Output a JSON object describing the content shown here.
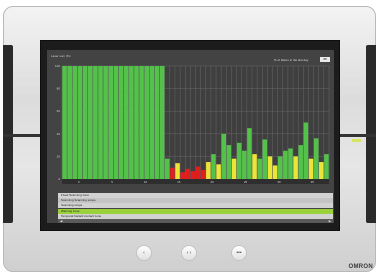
{
  "device": {
    "brand_logo": "OMRON",
    "led_color": "#d6e65a",
    "buttons": [
      {
        "name": "left-button",
        "symbol": "‹"
      },
      {
        "name": "center-button",
        "symbol": "‹ ›"
      },
      {
        "name": "right-button",
        "symbol": "•••"
      }
    ]
  },
  "screen": {
    "title": "Laser sum (%)",
    "slider_label": "% of failure in the last day",
    "slider_value": "88",
    "legend_rows": [
      {
        "label": "Fixed Scanning zone",
        "color": "#d2d2d2"
      },
      {
        "label": "Scanning Scanning scope",
        "color": "#c4c4c4"
      },
      {
        "label": "Scanning scope",
        "color": "#d2d2d2"
      },
      {
        "label": "Warning zone",
        "color": "#9bd23c"
      },
      {
        "label": "Temporal hazard contact zone",
        "color": "#d2d2d2"
      }
    ],
    "legend_footer_left": "◀",
    "legend_footer_right": "▶"
  },
  "chart_data": {
    "type": "bar",
    "ylim": [
      0,
      100
    ],
    "yticks": [
      "100",
      "80",
      "60",
      "40",
      "20",
      "0"
    ],
    "xticks": [
      "0",
      "5",
      "10",
      "15",
      "20",
      "25",
      "30",
      "35"
    ],
    "colors": {
      "green": "#54c24a",
      "yellow": "#ede43a",
      "red": "#e01e1e",
      "grid": "#707070",
      "bg": "#3f3f3f"
    },
    "bars": [
      {
        "v": 100,
        "c": "green"
      },
      {
        "v": 100,
        "c": "green"
      },
      {
        "v": 100,
        "c": "green"
      },
      {
        "v": 100,
        "c": "green"
      },
      {
        "v": 100,
        "c": "green"
      },
      {
        "v": 100,
        "c": "green"
      },
      {
        "v": 100,
        "c": "green"
      },
      {
        "v": 100,
        "c": "green"
      },
      {
        "v": 100,
        "c": "green"
      },
      {
        "v": 100,
        "c": "green"
      },
      {
        "v": 100,
        "c": "green"
      },
      {
        "v": 100,
        "c": "green"
      },
      {
        "v": 100,
        "c": "green"
      },
      {
        "v": 100,
        "c": "green"
      },
      {
        "v": 100,
        "c": "green"
      },
      {
        "v": 100,
        "c": "green"
      },
      {
        "v": 100,
        "c": "green"
      },
      {
        "v": 100,
        "c": "green"
      },
      {
        "v": 100,
        "c": "green"
      },
      {
        "v": 100,
        "c": "green"
      },
      {
        "v": 18,
        "c": "green"
      },
      {
        "v": 10,
        "c": "red"
      },
      {
        "v": 14,
        "c": "yellow"
      },
      {
        "v": 6,
        "c": "red"
      },
      {
        "v": 9,
        "c": "red"
      },
      {
        "v": 7,
        "c": "red"
      },
      {
        "v": 11,
        "c": "red"
      },
      {
        "v": 8,
        "c": "red"
      },
      {
        "v": 15,
        "c": "yellow"
      },
      {
        "v": 22,
        "c": "green"
      },
      {
        "v": 13,
        "c": "yellow"
      },
      {
        "v": 40,
        "c": "green"
      },
      {
        "v": 30,
        "c": "green"
      },
      {
        "v": 18,
        "c": "yellow"
      },
      {
        "v": 32,
        "c": "green"
      },
      {
        "v": 25,
        "c": "green"
      },
      {
        "v": 45,
        "c": "green"
      },
      {
        "v": 22,
        "c": "yellow"
      },
      {
        "v": 18,
        "c": "green"
      },
      {
        "v": 35,
        "c": "green"
      },
      {
        "v": 20,
        "c": "yellow"
      },
      {
        "v": 12,
        "c": "yellow"
      },
      {
        "v": 20,
        "c": "green"
      },
      {
        "v": 25,
        "c": "green"
      },
      {
        "v": 27,
        "c": "green"
      },
      {
        "v": 20,
        "c": "yellow"
      },
      {
        "v": 30,
        "c": "green"
      },
      {
        "v": 50,
        "c": "green"
      },
      {
        "v": 18,
        "c": "yellow"
      },
      {
        "v": 36,
        "c": "green"
      },
      {
        "v": 15,
        "c": "yellow"
      },
      {
        "v": 22,
        "c": "green"
      }
    ]
  }
}
